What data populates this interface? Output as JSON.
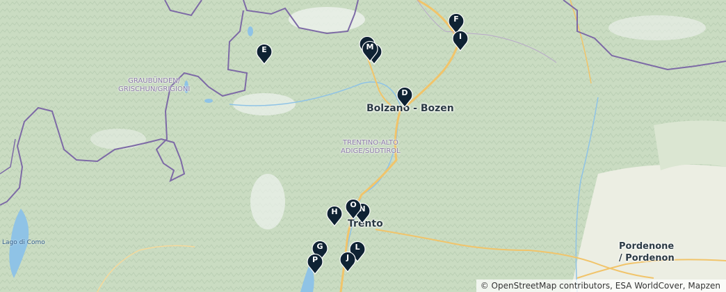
{
  "map": {
    "place_labels": {
      "bolzano": "Bolzano - Bozen",
      "trento": "Trento",
      "pordenone_line1": "Pordenone",
      "pordenone_line2": "/ Pordenon"
    },
    "region_labels": {
      "graubunden_line1": "GRAUBÜNDEN/",
      "graubunden_line2": "GRISCHUN/GRIGIONI",
      "trentino_line1": "TRENTINO-ALTO",
      "trentino_line2": "ADIGE/SÜDTIROL"
    },
    "water_labels": {
      "lago_di_como": "Lago di Como"
    },
    "markers": [
      {
        "label": "E"
      },
      {
        "label": "M"
      },
      {
        "label": "F"
      },
      {
        "label": "I"
      },
      {
        "label": "D"
      },
      {
        "label": "H"
      },
      {
        "label": "O"
      },
      {
        "label": "N"
      },
      {
        "label": "G"
      },
      {
        "label": "L"
      },
      {
        "label": "P"
      },
      {
        "label": "J"
      }
    ],
    "attribution": "© OpenStreetMap contributors, ESA WorldCover, Mapzen",
    "colors": {
      "marker_fill": "#0f2233",
      "border": "#7d6aa6",
      "water": "#8fc3e6",
      "road": "#f1c46a"
    }
  }
}
